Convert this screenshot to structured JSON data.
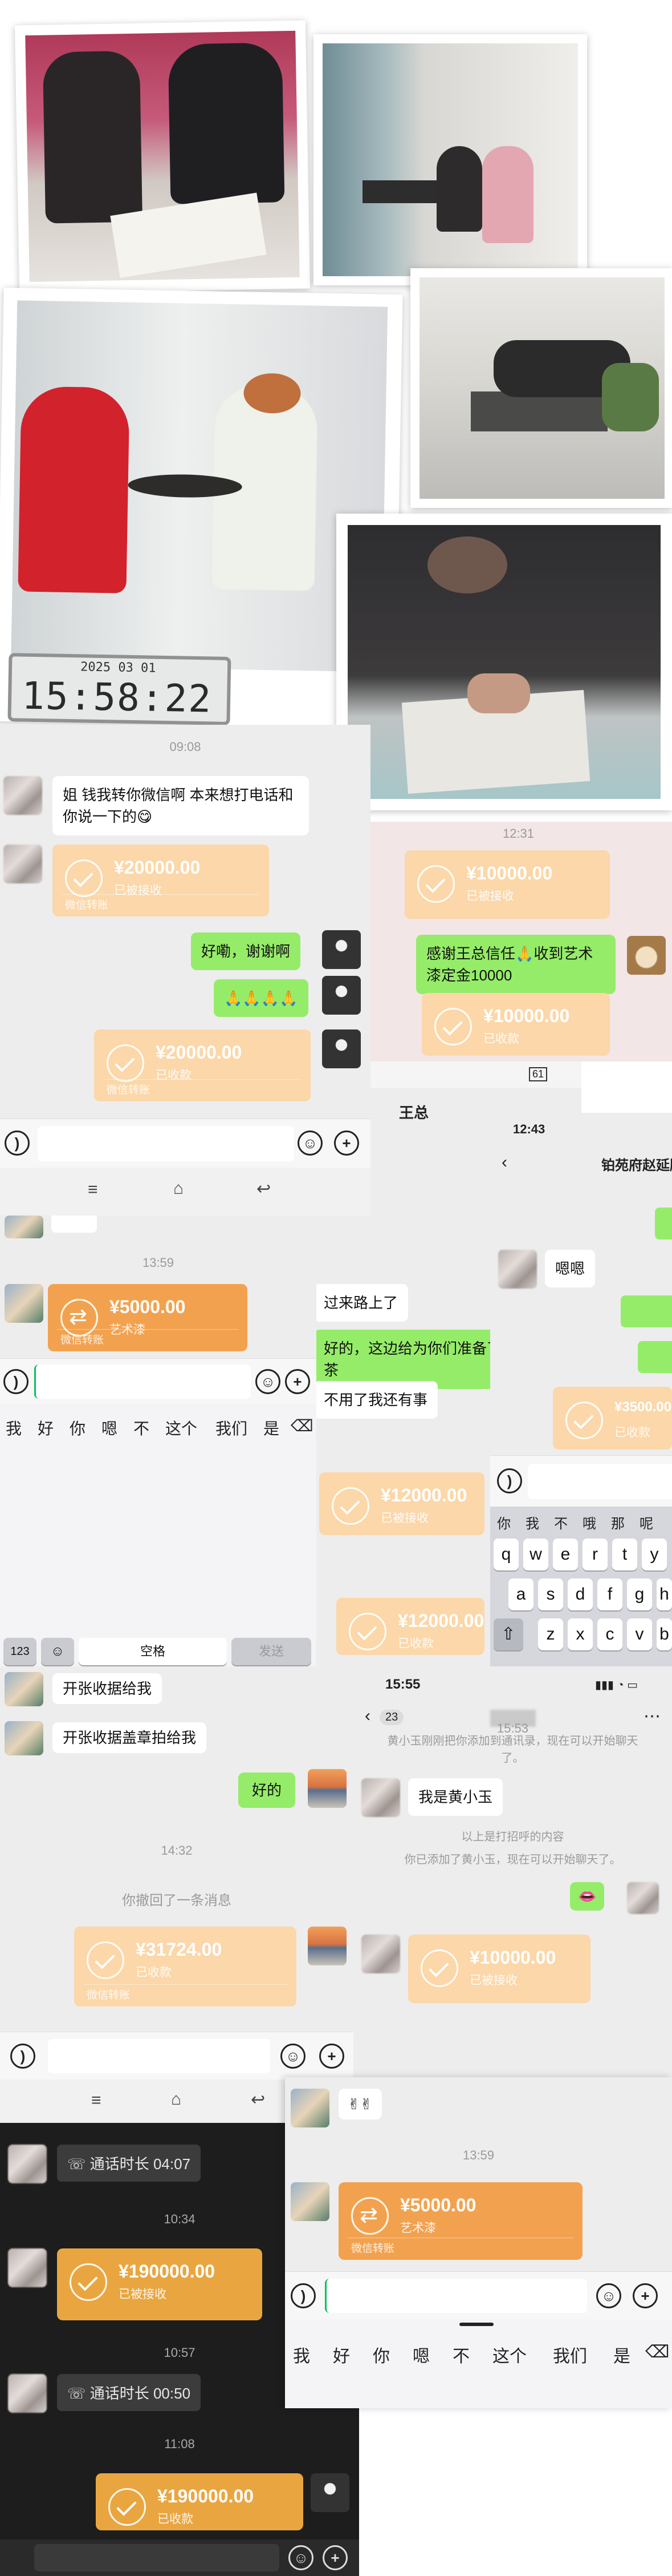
{
  "photos": {
    "clock_date": "2025 03 01",
    "clock_time": "15:58:22"
  },
  "chat1": {
    "time": "09:08",
    "msg_sister": "姐 钱我转你微信啊 本来想打电话和你说一下的😋",
    "transfer1_amount": "¥20000.00",
    "transfer1_status": "已被接收",
    "msg_reply_ok": "好嘞，谢谢啊",
    "msg_reply_emoji": "🙏🙏🙏🙏",
    "transfer2_amount": "¥20000.00",
    "transfer2_status": "已收款",
    "transfer_foot": "微信转账"
  },
  "chat2": {
    "time": "12:31",
    "transfer1_amount": "¥10000.00",
    "transfer1_status": "已被接收",
    "msg_thanks": "感谢王总信任🙏收到艺术漆定金10000",
    "transfer2_amount": "¥10000.00",
    "transfer2_status": "已收款"
  },
  "chat3": {
    "time": "13:59",
    "transfer_amount": "¥5000.00",
    "transfer_note": "艺术漆",
    "transfer_foot": "微信转账",
    "candidates": [
      "我",
      "好",
      "你",
      "嗯",
      "不",
      "这个",
      "我们",
      "是"
    ],
    "kb_123": "123",
    "kb_space": "空格",
    "kb_send": "发送"
  },
  "chat4": {
    "title": "王总",
    "msg_on_way": "过来路上了",
    "msg_prepared": "好的，这边给为你们准备了茶",
    "msg_no_need": "不用了我还有事",
    "transfer1_amount": "¥12000.00",
    "transfer1_status": "已被接收",
    "transfer2_amount": "¥12000.00",
    "transfer2_status": "已收款",
    "status_battery": "61"
  },
  "chat5": {
    "time": "12:43",
    "title": "铂苑府赵延胜",
    "msg_ok": "嗯嗯",
    "transfer_amount": "¥3500.00",
    "transfer_status": "已收款",
    "candidates": [
      "你",
      "我",
      "不",
      "哦",
      "那",
      "呢"
    ],
    "row1": [
      "q",
      "w",
      "e",
      "r",
      "t",
      "y"
    ],
    "row2": [
      "a",
      "s",
      "d",
      "f",
      "g",
      "h"
    ],
    "row3": [
      "z",
      "x",
      "c",
      "v",
      "b"
    ]
  },
  "chat6": {
    "msg_receipt": "开张收据给我",
    "msg_receipt_stamp": "开张收据盖章拍给我",
    "msg_good": "好的",
    "time": "14:32",
    "recall": "你撤回了一条消息",
    "transfer_amount": "¥31724.00",
    "transfer_status": "已收款",
    "transfer_foot": "微信转账"
  },
  "chat7": {
    "status_time": "15:55",
    "back_count": "23",
    "sys_added": "黄小玉刚刚把你添加到通讯录，现在可以开始聊天了。",
    "msg_name": "我是黄小玉",
    "sys_greet": "以上是打招呼的内容",
    "sys_added2": "你已添加了黄小玉，现在可以开始聊天了。",
    "time": "15:53",
    "emoji": "👄",
    "transfer_amount": "¥10000.00",
    "transfer_status": "已被接收"
  },
  "chat8": {
    "call1": "通话时长 04:07",
    "time1": "10:34",
    "transfer1_amount": "¥190000.00",
    "transfer1_status": "已被接收",
    "time2": "10:57",
    "call2": "通话时长 00:50",
    "time3": "11:08",
    "transfer2_amount": "¥190000.00",
    "transfer2_status": "已收款"
  },
  "chat9": {
    "emoji": "✌✌",
    "time": "13:59",
    "transfer_amount": "¥5000.00",
    "transfer_note": "艺术漆",
    "transfer_foot": "微信转账",
    "candidates": [
      "我",
      "好",
      "你",
      "嗯",
      "不",
      "这个",
      "我们",
      "是"
    ]
  }
}
